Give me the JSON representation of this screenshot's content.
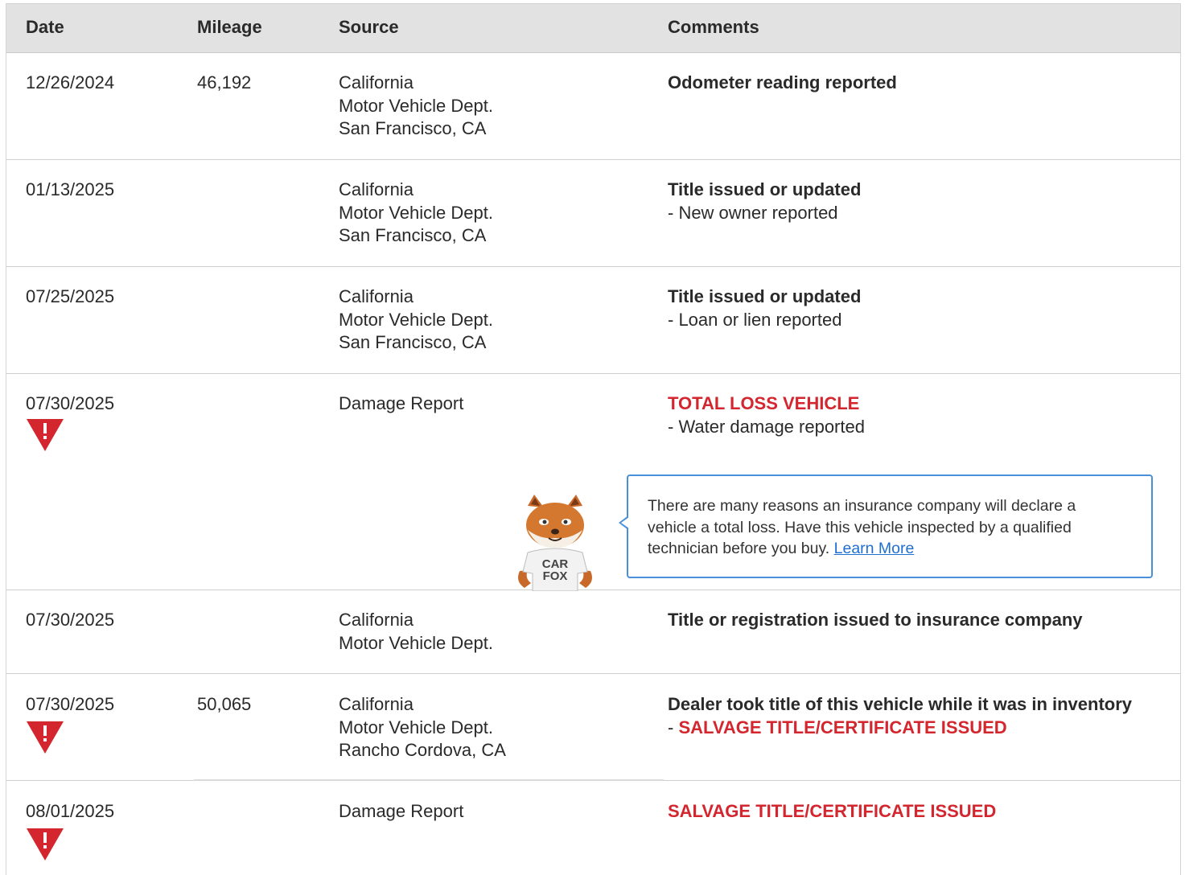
{
  "table": {
    "headers": {
      "date": "Date",
      "mileage": "Mileage",
      "source": "Source",
      "comments": "Comments"
    },
    "rows": [
      {
        "date": "12/26/2024",
        "mileage": "46,192",
        "source": [
          "California",
          "Motor Vehicle Dept.",
          "San Francisco, CA"
        ],
        "comment_title": "Odometer reading reported",
        "comment_detail": ""
      },
      {
        "date": "01/13/2025",
        "mileage": "",
        "source": [
          "California",
          "Motor Vehicle Dept.",
          "San Francisco, CA"
        ],
        "comment_title": "Title issued or updated",
        "comment_detail": "- New owner reported"
      },
      {
        "date": "07/25/2025",
        "mileage": "",
        "source": [
          "California",
          "Motor Vehicle Dept.",
          "San Francisco, CA"
        ],
        "comment_title": "Title issued or updated",
        "comment_detail": "- Loan or lien reported"
      },
      {
        "date": "07/30/2025",
        "mileage": "",
        "source": [
          "Damage Report"
        ],
        "comment_title": "TOTAL LOSS VEHICLE",
        "comment_detail": "- Water damage reported",
        "alert_icon": "warning-triangle-icon"
      },
      {
        "date": "07/30/2025",
        "mileage": "",
        "source": [
          "California",
          "Motor Vehicle Dept."
        ],
        "comment_title": "Title or registration issued to insurance company",
        "comment_detail": ""
      },
      {
        "date": "07/30/2025",
        "mileage": "50,065",
        "source": [
          "California",
          "Motor Vehicle Dept.",
          "Rancho Cordova, CA"
        ],
        "comment_title": "Dealer took title of this vehicle while it was in inventory",
        "comment_detail_prefix": "- ",
        "comment_detail": "SALVAGE TITLE/CERTIFICATE ISSUED",
        "alert_icon": "warning-triangle-icon"
      },
      {
        "date": "08/01/2025",
        "mileage": "",
        "source": [
          "Damage Report"
        ],
        "comment_title": "SALVAGE TITLE/CERTIFICATE ISSUED",
        "comment_detail": "",
        "alert_icon": "warning-triangle-icon"
      }
    ]
  },
  "callout": {
    "text": "There are many reasons an insurance company will declare a vehicle a total loss. Have this vehicle inspected by a qualified technician before you buy.",
    "link_label": "Learn More",
    "mascot_shirt": [
      "CAR",
      "FOX"
    ]
  },
  "colors": {
    "alert_red": "#d3262e",
    "link_blue": "#1f6fd1",
    "header_bg": "#e2e2e2",
    "callout_border": "#4a90d9"
  }
}
